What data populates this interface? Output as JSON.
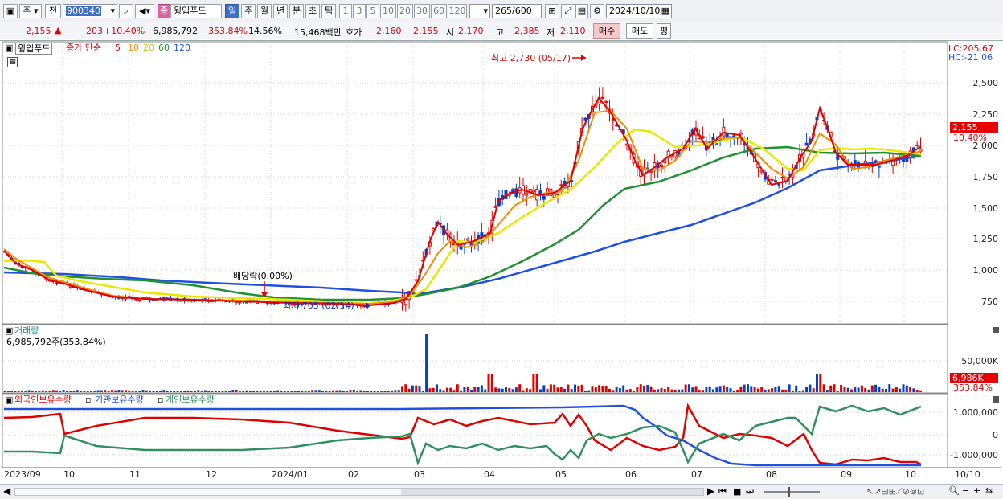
{
  "toolbar": {
    "mode": "주",
    "prev_label": "전",
    "code": "900340",
    "stock_name_tag": "종",
    "stock_name": "윙입푸드",
    "periods": [
      "일",
      "주",
      "월",
      "년",
      "분",
      "초",
      "틱"
    ],
    "active_period": "일",
    "intervals": [
      "1",
      "3",
      "5",
      "10",
      "20",
      "30",
      "60",
      "120"
    ],
    "count_display": "265",
    "count_total": "/600",
    "date": "2024/10/10"
  },
  "quote": {
    "price": "2,155",
    "price_arrow": "▲",
    "change": "203",
    "change_pct": "+10.40%",
    "volume": "6,985,792",
    "volume_ratio": "353.84%",
    "turnover": "14.56%",
    "amount": "15,468백만",
    "ask_label": "호가",
    "ask1": "2,160",
    "ask2": "2,155",
    "open_label": "시",
    "open": "2,170",
    "high_label": "고",
    "high": "2,385",
    "low_label": "저",
    "low": "2,110",
    "buy_label": "매수",
    "sell_label": "매도",
    "eval_label": "평"
  },
  "price_panel": {
    "title": "윙입푸드",
    "ma_prefix": "종가 단순",
    "ma_periods": [
      "5",
      "10",
      "20",
      "60",
      "120"
    ],
    "ma_colors": [
      "#e00000",
      "#f08c00",
      "#d8d800",
      "#209030",
      "#2050e0"
    ],
    "lc": "LC:205.67",
    "hc": "HC:-21.06",
    "high_note": "최고 2,730 (05/17)",
    "low_note": "최저 705 (02/14)",
    "dividend_note": "배당락(0.00%)",
    "y_ticks": [
      "2,500",
      "2,250",
      "2,000",
      "1,750",
      "1,500",
      "1,250",
      "1,000",
      "750"
    ],
    "last_price_tag": "2,155",
    "last_pct_tag": "10.40%"
  },
  "volume_panel": {
    "title": "거래량",
    "value": "6,985,792주(353.84%)",
    "y_tick": "50,000K",
    "last_tag": "6,986K",
    "last_pct": "353.84%"
  },
  "holding_panel": {
    "series": [
      "외국인보유수량",
      "기관보유수량",
      "개인보유수량"
    ],
    "series_colors": [
      "#e00000",
      "#2050e0",
      "#309060"
    ],
    "y_ticks": [
      "1,000,000",
      "0",
      "-1,000,000"
    ]
  },
  "x_axis": {
    "labels": [
      "2023/09",
      "10",
      "11",
      "12",
      "2024/01",
      "02",
      "03",
      "04",
      "05",
      "06",
      "07",
      "08",
      "09",
      "10"
    ],
    "right_label": "10/10"
  }
}
